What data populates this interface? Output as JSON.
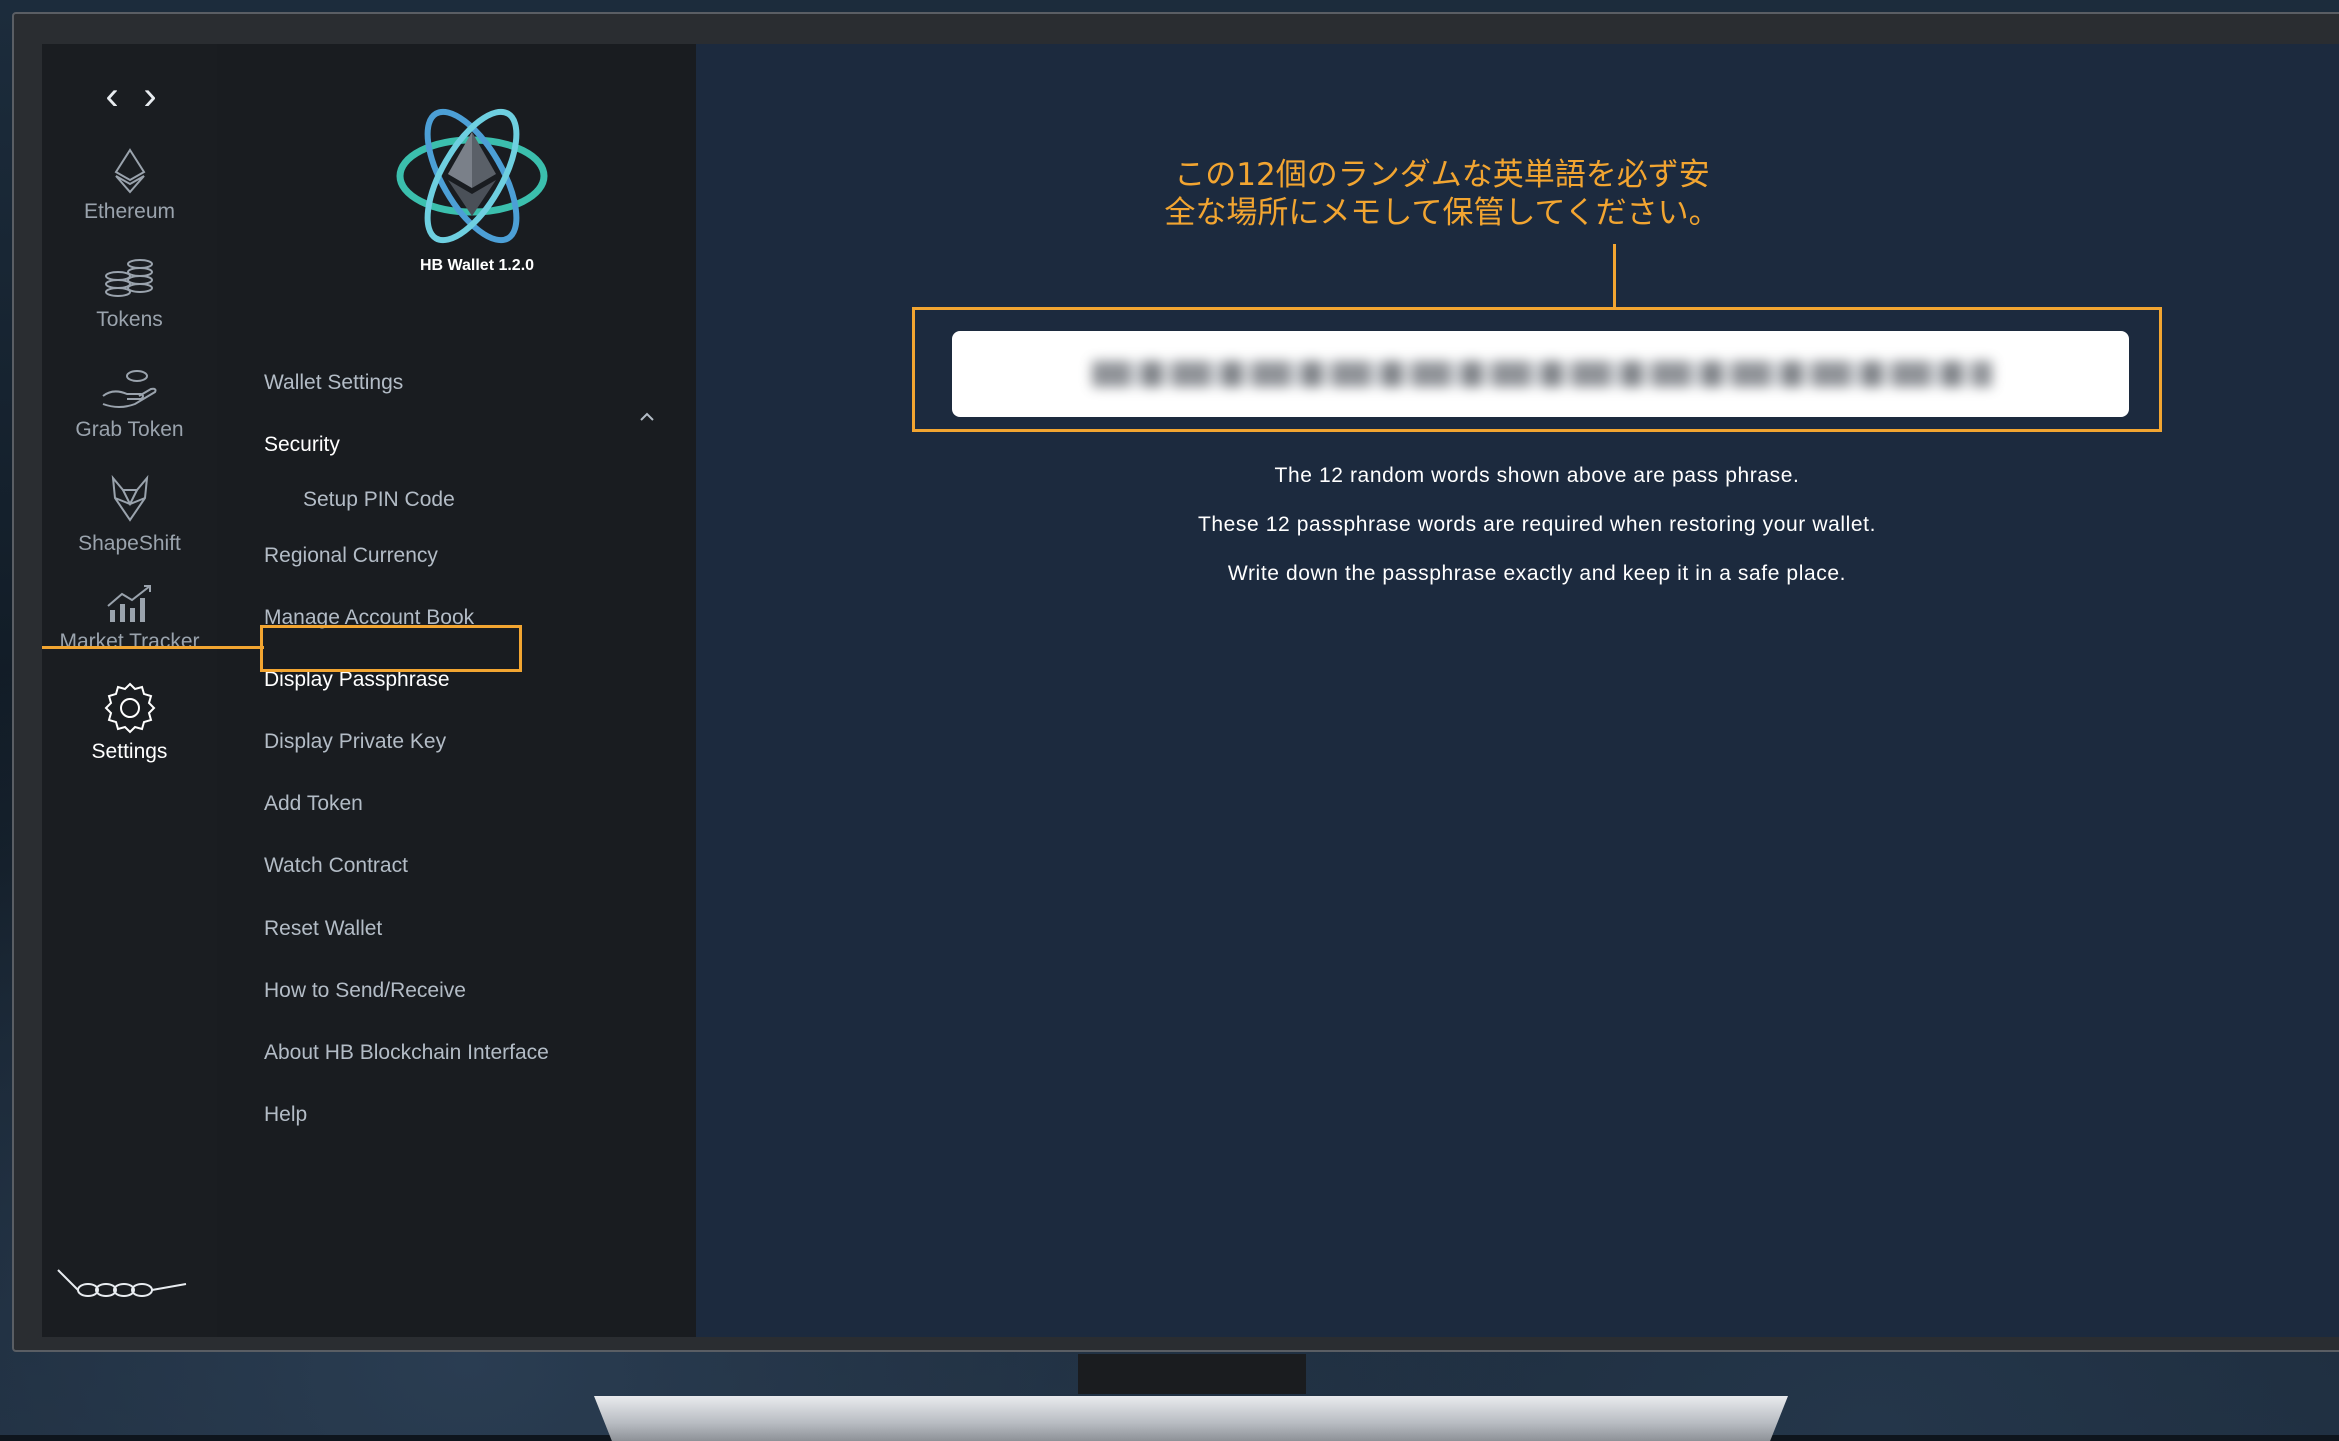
{
  "app": {
    "name_version": "HB Wallet 1.2.0"
  },
  "rail": {
    "items": [
      {
        "label": "Ethereum",
        "icon": "ethereum-icon"
      },
      {
        "label": "Tokens",
        "icon": "tokens-icon"
      },
      {
        "label": "Grab Token",
        "icon": "grab-token-icon"
      },
      {
        "label": "ShapeShift",
        "icon": "shapeshift-icon"
      },
      {
        "label": "Market Tracker",
        "icon": "market-tracker-icon"
      },
      {
        "label": "Settings",
        "icon": "gear-icon",
        "active": true
      }
    ],
    "back_glyph": "‹",
    "forward_glyph": "›"
  },
  "menu": {
    "items": [
      {
        "label": "Wallet Settings"
      },
      {
        "label": "Security",
        "expanded": true
      },
      {
        "label": "Setup PIN Code",
        "sub": true
      },
      {
        "label": "Regional Currency"
      },
      {
        "label": "Manage Account Book"
      },
      {
        "label": "Display Passphrase",
        "selected": true
      },
      {
        "label": "Display Private Key"
      },
      {
        "label": "Add Token"
      },
      {
        "label": "Watch Contract"
      },
      {
        "label": "Reset Wallet"
      },
      {
        "label": "How to Send/Receive"
      },
      {
        "label": "About HB Blockchain Interface"
      },
      {
        "label": "Help"
      }
    ]
  },
  "main": {
    "annotation_line1": "この12個のランダムな英単語を必ず安",
    "annotation_line2": "全な場所にメモして保管してください。",
    "info": [
      "The 12 random words shown above are pass phrase.",
      "These 12 passphrase words are required when restoring your wallet.",
      "Write down the passphrase exactly and keep it in a safe place."
    ]
  },
  "colors": {
    "accent": "#f2a531",
    "content_bg": "#1c2a3e",
    "menu_bg": "#191c20",
    "rail_bg": "#1a1d21"
  }
}
